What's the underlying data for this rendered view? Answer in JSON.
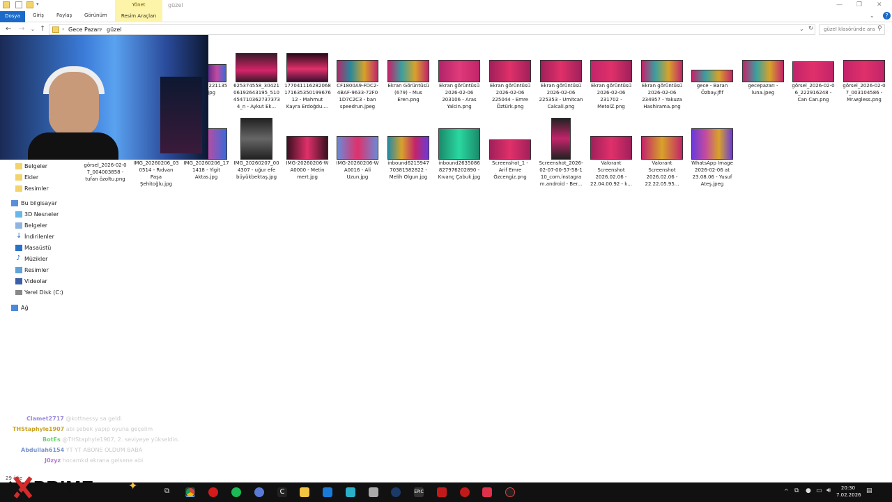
{
  "window": {
    "manage_tab": "Yönet",
    "title": "güzel",
    "controls": [
      "—",
      "❐",
      "✕"
    ]
  },
  "ribbon": {
    "tabs": [
      "Dosya",
      "Giriş",
      "Paylaş",
      "Görünüm",
      "Resim Araçları"
    ]
  },
  "address": {
    "crumbs": [
      "Gece Pazarı",
      "güzel"
    ],
    "search_placeholder": "güzel klasöründe ara"
  },
  "sidebar": {
    "items": [
      "Belgeler",
      "Ekler",
      "Resimler",
      "Bu bilgisayar",
      "3D Nesneler",
      "Belgeler",
      "İndirilenler",
      "Masaüstü",
      "Müzikler",
      "Resimler",
      "Videolar",
      "Yerel Disk (C:)",
      "Ağ"
    ]
  },
  "files_row1": [
    {
      "name": "_221135\n.jpg"
    },
    {
      "name": "625374558_30421\n06192643195_510\n454710362737373\n4_n - Aykut Ek..."
    },
    {
      "name": "177041116282068\n171635350199676\n12 - Mahmut\nKayra Erdoğdu...."
    },
    {
      "name": "CF1800A9-FDC2-\n4BAF-9633-72F0\n1D7C2C3 - ban\nspeedrun.jpeg"
    },
    {
      "name": "Ekran Görüntüsü\n(679) - Mus\nEren.png"
    },
    {
      "name": "Ekran görüntüsü\n2026-02-06\n203106 - Aras\nYalcin.png"
    },
    {
      "name": "Ekran görüntüsü\n2026-02-06\n225044 - Emre\nÖztürk.png"
    },
    {
      "name": "Ekran görüntüsü\n2026-02-06\n225353 - Umitcan\nCalcali.png"
    },
    {
      "name": "Ekran görüntüsü\n2026-02-06\n231702 -\nMetolZ.png"
    },
    {
      "name": "Ekran görüntüsü\n2026-02-06\n234957 - Yakuza\nHashirama.png"
    },
    {
      "name": "gece - Baran\nÖzbay.jfif"
    },
    {
      "name": "gecepazarı -\nluna.jpeg"
    },
    {
      "name": "görsel_2026-02-0\n6_222916248 -\nCan Can.png"
    },
    {
      "name": "görsel_2026-02-0\n7_003104586 -\nMr.wgless.png"
    }
  ],
  "files_row2": [
    {
      "name": "görsel_2026-02-0\n7_004003858 -\ntufan özoltu.png"
    },
    {
      "name": "IMG_20260206_03\n0514 - Rıdvan\nPaşa\nŞehitoğlu.jpg"
    },
    {
      "name": "IMG_20260206_17\n1418 - Yigit\nAktas.jpg"
    },
    {
      "name": "IMG_20260207_00\n4307 - uğur efe\nbüyükbektaş.jpg"
    },
    {
      "name": "IMG-20260206-W\nA0000 - Metin\nmert.jpg"
    },
    {
      "name": "IMG-20260206-W\nA0016 - Ali\nUzun.jpg"
    },
    {
      "name": "inbound6215947\n70381582822 -\nMelih Olgun.jpg"
    },
    {
      "name": "inbound2635086\n827976202890 -\nKıvanç Çabuk.jpg"
    },
    {
      "name": "Screenshot_1 -\nArif Emre\nÖzcengiz.png"
    },
    {
      "name": "Screenshot_2026-\n02-07-00-57-58-1\n10_com.instagra\nm.android - Ber..."
    },
    {
      "name": "Valorant\nScreenshot\n2026.02.06 -\n22.04.00.92 - k..."
    },
    {
      "name": "Valorant\nScreenshot\n2026.02.06 -\n22.22.05.95..."
    },
    {
      "name": "WhatsApp Image\n2026-02-06 at\n23.08.06 - Yusuf\nAteş.jpeg"
    }
  ],
  "chat": [
    {
      "user": "Clamet2717",
      "msg": "@kottnessy sa geldi",
      "color": "#9b8bd8"
    },
    {
      "user": "THStaphyle1907",
      "msg": "abi şebek yapıp oyuna geçelim",
      "color": "#c9a227"
    },
    {
      "user": "BotEs",
      "msg": "@THStaphyle1907, 2. seviyeye yükseldin.",
      "color": "#6bd36b"
    },
    {
      "user": "Abdullah6154",
      "msg": "YT YT ABONE OLDUM BABA",
      "color": "#7a96c9"
    },
    {
      "user": "J0zyz",
      "msg": "hocamkd ekrana gelsene abi",
      "color": "#b07ad0"
    }
  ],
  "status": {
    "count": "29 öğe"
  },
  "brand": {
    "logo": "PRIME"
  },
  "clock": {
    "time": "20:30",
    "date": "7.02.2026"
  }
}
